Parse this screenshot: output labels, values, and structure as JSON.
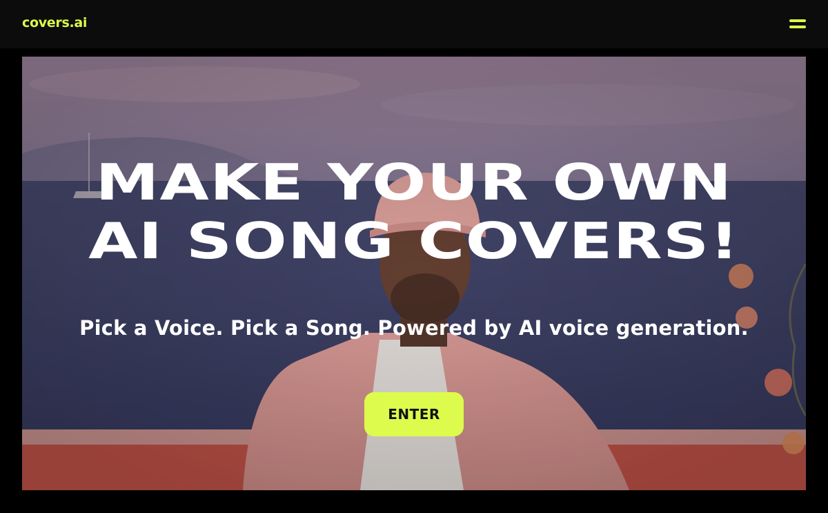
{
  "brand": {
    "logo_text": "covers.ai",
    "accent": "#dcfb4c"
  },
  "nav": {
    "menu_icon": "hamburger-menu-icon"
  },
  "hero": {
    "headline_line1": "MAKE YOUR OWN",
    "headline_line2": "AI SONG COVERS!",
    "subheadline": "Pick a Voice. Pick a Song. Powered by AI voice generation.",
    "cta_label": "ENTER"
  },
  "colors": {
    "background": "#000000",
    "topbar": "#0c0c0c",
    "text": "#ffffff",
    "cta_text": "#111111"
  }
}
